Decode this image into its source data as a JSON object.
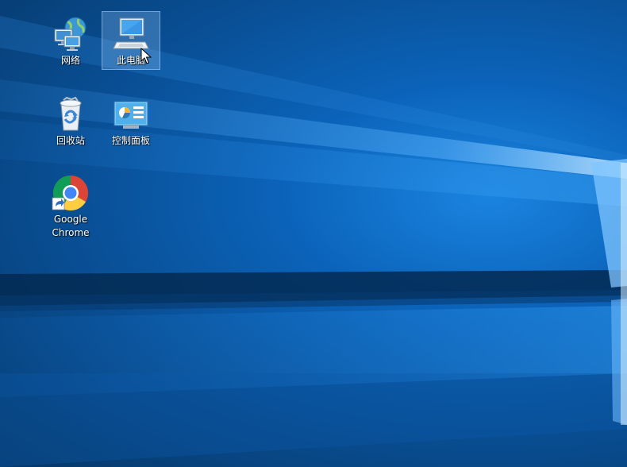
{
  "desktop": {
    "icons": [
      {
        "label": "网络",
        "icon": "network-icon",
        "selected": false
      },
      {
        "label": "此电脑",
        "icon": "this-pc-icon",
        "selected": true
      },
      {
        "label": "回收站",
        "icon": "recycle-bin-icon",
        "selected": false
      },
      {
        "label": "控制面板",
        "icon": "control-panel-icon",
        "selected": false
      },
      {
        "label": "Google Chrome",
        "icon": "chrome-icon",
        "selected": false,
        "shortcut": true
      }
    ]
  },
  "colors": {
    "wallpaper_dark": "#063767",
    "wallpaper_light": "#1a84e0",
    "selection": "#99ccff"
  }
}
